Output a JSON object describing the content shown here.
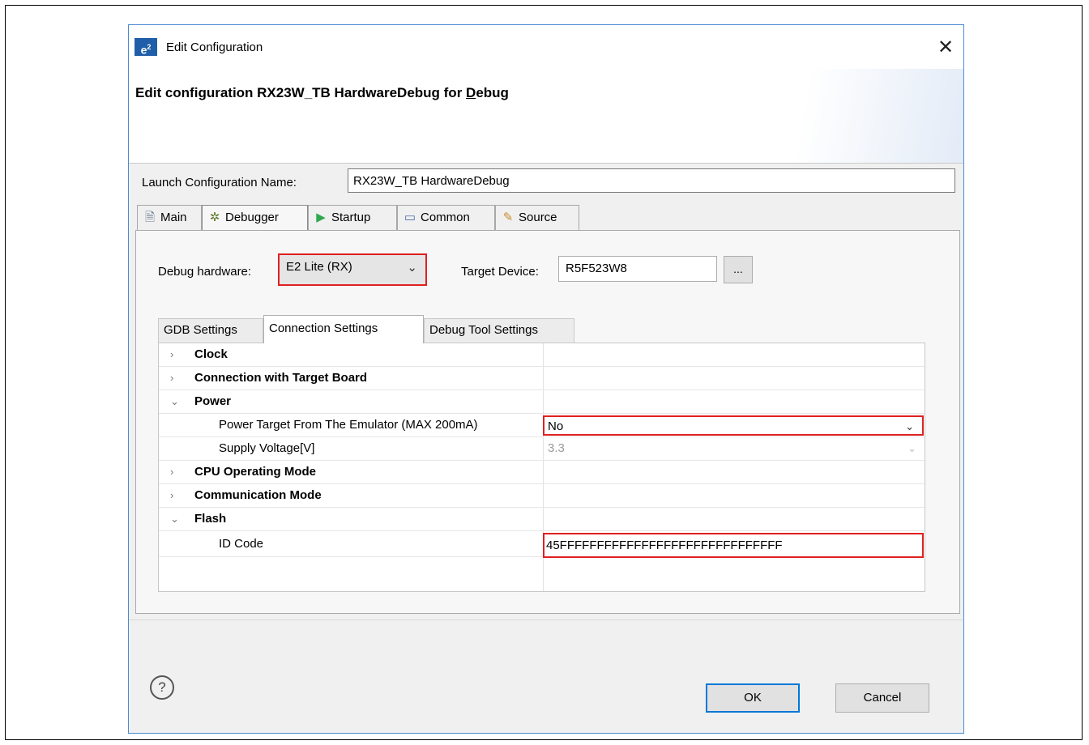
{
  "window": {
    "app_icon": "e²",
    "title": "Edit Configuration",
    "close_glyph": "✕"
  },
  "banner": {
    "title_prefix": "Edit configuration RX23W_TB HardwareDebug for ",
    "title_accel": "D",
    "title_suffix": "ebug"
  },
  "launch": {
    "label": "Launch Configuration Name:",
    "value": "RX23W_TB HardwareDebug"
  },
  "tabs": [
    {
      "label": "Main",
      "icon": "document-icon",
      "glyph": "🗎"
    },
    {
      "label": "Debugger",
      "icon": "bug-icon",
      "glyph": "✲"
    },
    {
      "label": "Startup",
      "icon": "play-icon",
      "glyph": "▶"
    },
    {
      "label": "Common",
      "icon": "window-icon",
      "glyph": "▭"
    },
    {
      "label": "Source",
      "icon": "source-icon",
      "glyph": "✎"
    }
  ],
  "active_tab": "Debugger",
  "debugger": {
    "hw_label": "Debug hardware:",
    "hw_value": "E2 Lite (RX)",
    "target_label": "Target Device:",
    "target_value": "R5F523W8",
    "browse_label": "..."
  },
  "subtabs": [
    "GDB Settings",
    "Connection Settings",
    "Debug Tool Settings"
  ],
  "active_subtab": "Connection Settings",
  "properties": [
    {
      "name": "Clock",
      "level": 0,
      "expanded": false,
      "value": ""
    },
    {
      "name": "Connection with Target Board",
      "level": 0,
      "expanded": false,
      "value": ""
    },
    {
      "name": "Power",
      "level": 0,
      "expanded": true,
      "value": ""
    },
    {
      "name": "Power Target From The Emulator (MAX 200mA)",
      "level": 1,
      "value": "No",
      "dropdown": true,
      "highlight": true
    },
    {
      "name": "Supply Voltage[V]",
      "level": 1,
      "value": "3.3",
      "dropdown": true,
      "disabled": true
    },
    {
      "name": "CPU Operating Mode",
      "level": 0,
      "expanded": false,
      "value": ""
    },
    {
      "name": "Communication Mode",
      "level": 0,
      "expanded": false,
      "value": ""
    },
    {
      "name": "Flash",
      "level": 0,
      "expanded": true,
      "value": ""
    },
    {
      "name": "ID Code",
      "level": 1,
      "value": "45FFFFFFFFFFFFFFFFFFFFFFFFFFFFFF",
      "highlight": true
    }
  ],
  "buttons": {
    "ok": "OK",
    "cancel": "Cancel",
    "help": "?"
  },
  "colors": {
    "highlight": "#e02020",
    "accent": "#0078d7"
  }
}
